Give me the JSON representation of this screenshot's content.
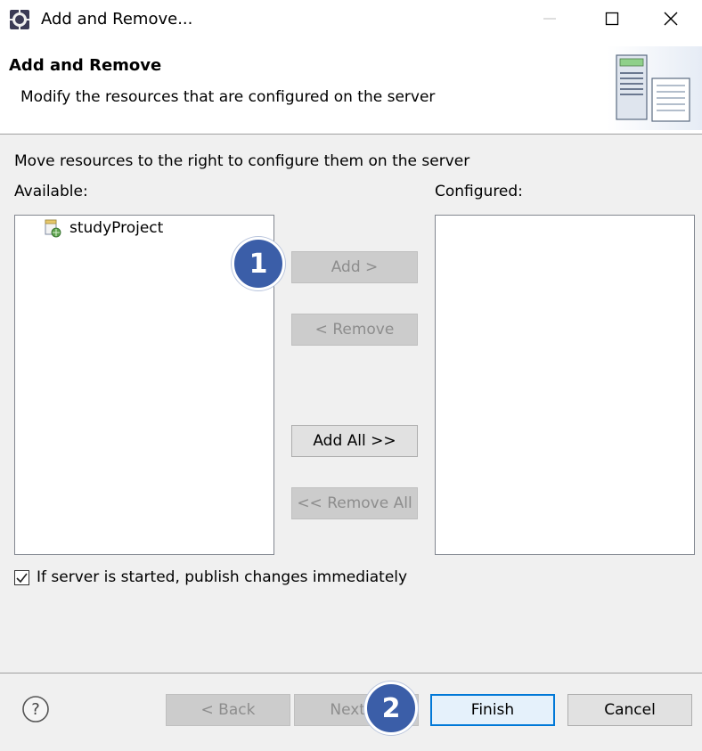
{
  "window": {
    "title": "Add and Remove...",
    "minimize_icon": "minimize-icon",
    "maximize_icon": "maximize-icon",
    "close_icon": "close-icon"
  },
  "header": {
    "title": "Add and Remove",
    "description": "Modify the resources that are configured on the server",
    "image_icon": "server-icon"
  },
  "body": {
    "instruction": "Move resources to the right to configure them on the server",
    "available_label": "Available:",
    "configured_label": "Configured:",
    "available_items": [
      {
        "label": "studyProject",
        "icon": "web-project-icon"
      }
    ],
    "configured_items": [],
    "buttons": {
      "add": "Add >",
      "remove": "< Remove",
      "add_all": "Add All >>",
      "remove_all": "<< Remove All"
    },
    "publish_checkbox": {
      "label": "If server is started, publish changes immediately",
      "checked": true
    }
  },
  "footer": {
    "help_icon": "help-icon",
    "back": "< Back",
    "next": "Next >",
    "finish": "Finish",
    "cancel": "Cancel"
  },
  "annotations": [
    {
      "number": "1",
      "color": "#3b5ea8"
    },
    {
      "number": "2",
      "color": "#3b5ea8"
    }
  ]
}
